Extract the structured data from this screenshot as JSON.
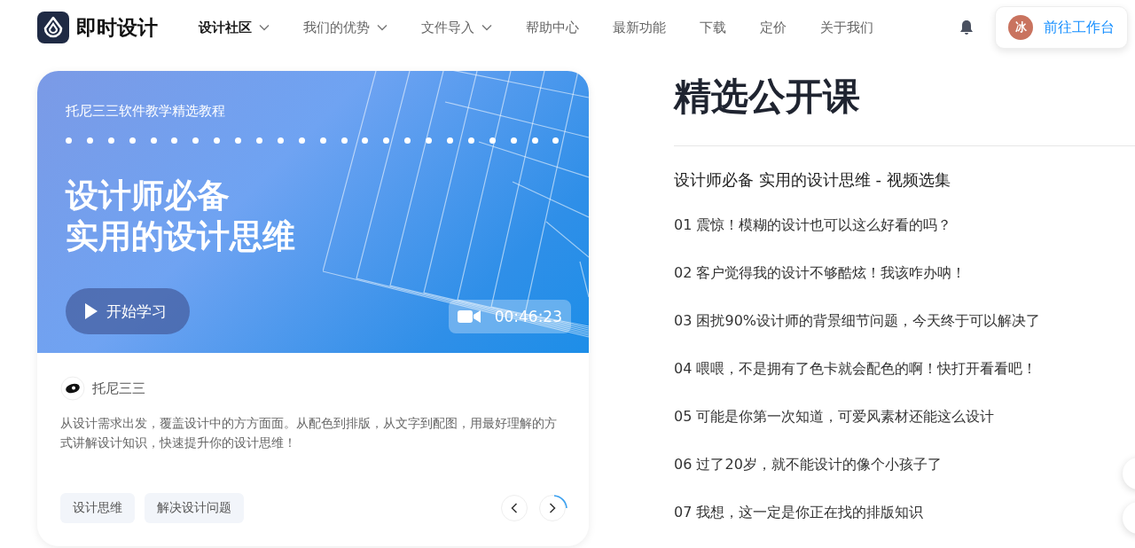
{
  "brand": {
    "name": "即时设计"
  },
  "nav": [
    {
      "label": "设计社区",
      "selected": true,
      "dropdown": true
    },
    {
      "label": "我们的优势",
      "selected": false,
      "dropdown": true
    },
    {
      "label": "文件导入",
      "selected": false,
      "dropdown": true
    },
    {
      "label": "帮助中心",
      "selected": false,
      "dropdown": false
    },
    {
      "label": "最新功能",
      "selected": false,
      "dropdown": false
    },
    {
      "label": "下载",
      "selected": false,
      "dropdown": false
    },
    {
      "label": "定价",
      "selected": false,
      "dropdown": false
    },
    {
      "label": "关于我们",
      "selected": false,
      "dropdown": false
    }
  ],
  "user": {
    "avatar": "冰",
    "button": "前往工作台"
  },
  "card": {
    "kicker": "托尼三三软件教学精选教程",
    "headline": [
      "设计师必备",
      "实用的设计思维"
    ],
    "play_button": "开始学习",
    "duration": "00:46:23",
    "author": "托尼三三",
    "description": "从设计需求出发，覆盖设计中的方方面面。从配色到排版，从文字到配图，用最好理解的方式讲解设计知识，快速提升你的设计思维！",
    "tags": [
      "设计思维",
      "解决设计问题"
    ]
  },
  "course": {
    "title": "精选公开课",
    "subtitle": "设计师必备 实用的设计思维 - 视频选集",
    "lessons": [
      "01 震惊！模糊的设计也可以这么好看的吗？",
      "02 客户觉得我的设计不够酷炫！我该咋办呐！",
      "03 困扰90%设计师的背景细节问题，今天终于可以解决了",
      "04 喂喂，不是拥有了色卡就会配色的啊！快打开看看吧！",
      "05 可能是你第一次知道，可爱风素材还能这么设计",
      "06 过了20岁，就不能设计的像个小孩子了",
      "07 我想，这一定是你正在找的排版知识"
    ]
  }
}
